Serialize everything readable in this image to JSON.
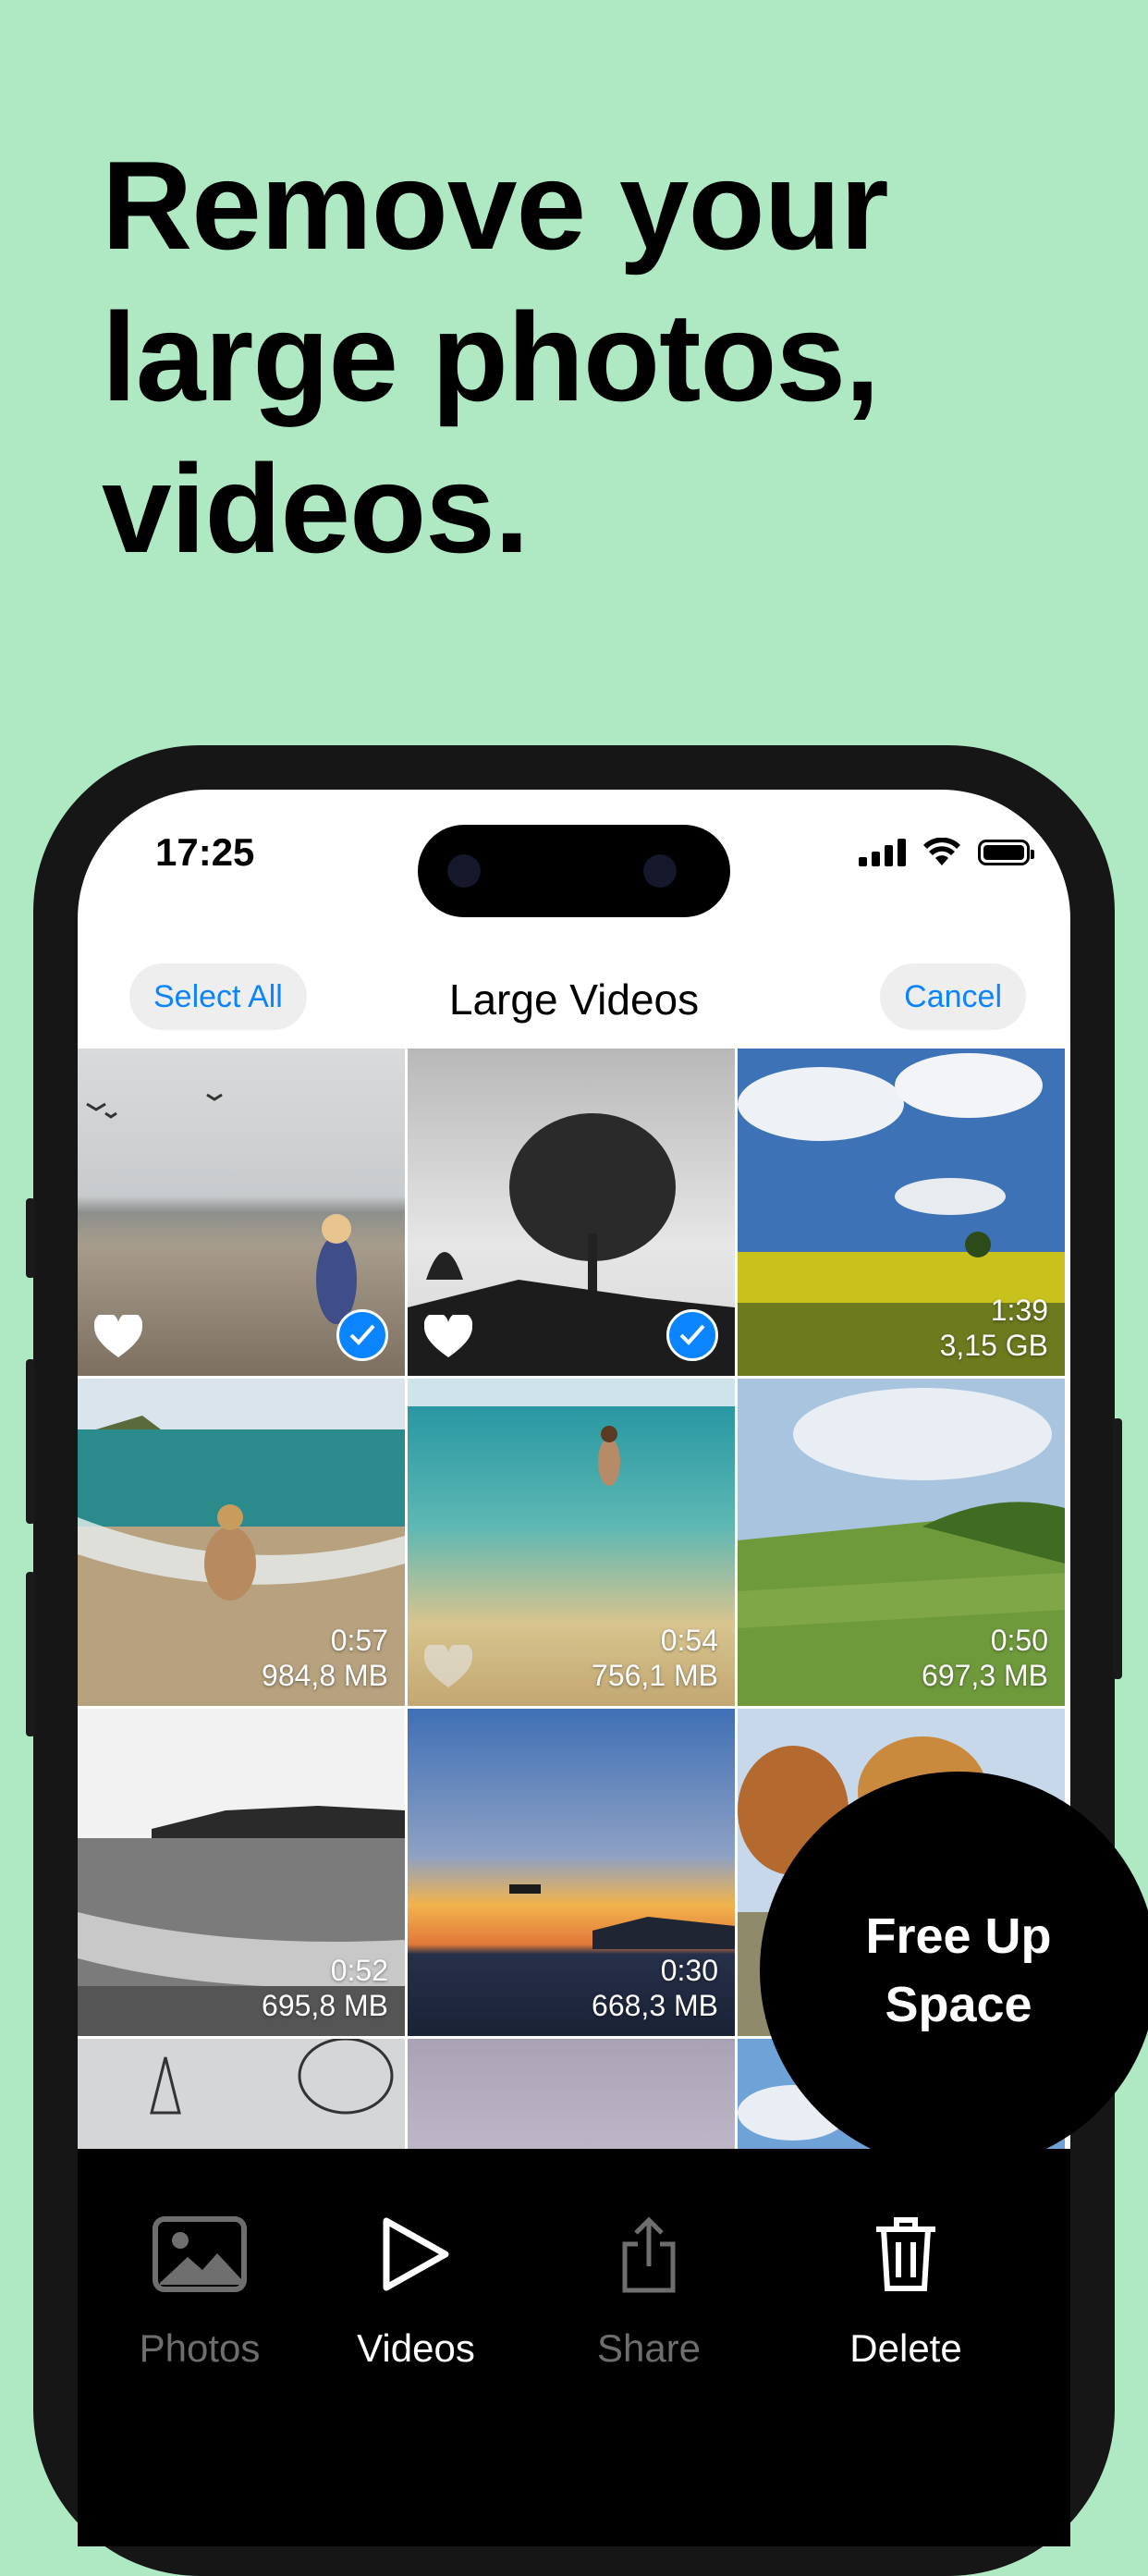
{
  "headline": [
    "Remove your",
    "large photos,",
    "videos."
  ],
  "status": {
    "time": "17:25"
  },
  "navbar": {
    "select_all": "Select All",
    "title": "Large Videos",
    "cancel": "Cancel"
  },
  "grid": [
    {
      "name": "beach-child",
      "favorite": true,
      "selected": true,
      "duration": "",
      "size": ""
    },
    {
      "name": "tree-silhouette",
      "favorite": true,
      "selected": true,
      "duration": "",
      "size": ""
    },
    {
      "name": "field-sky",
      "favorite": false,
      "selected": false,
      "duration": "1:39",
      "size": "3,15 GB"
    },
    {
      "name": "beach-woman-sitting",
      "favorite": false,
      "selected": false,
      "duration": "0:57",
      "size": "984,8 MB"
    },
    {
      "name": "sea-woman-standing",
      "favorite": false,
      "selected": false,
      "duration": "0:54",
      "size": "756,1 MB"
    },
    {
      "name": "green-hills",
      "favorite": false,
      "selected": false,
      "duration": "0:50",
      "size": "697,3 MB"
    },
    {
      "name": "bw-coast",
      "favorite": false,
      "selected": false,
      "duration": "0:52",
      "size": "695,8 MB"
    },
    {
      "name": "sunset-drone",
      "favorite": false,
      "selected": false,
      "duration": "0:30",
      "size": "668,3 MB"
    },
    {
      "name": "autumn-trees",
      "favorite": false,
      "selected": false,
      "duration": "",
      "size": ""
    },
    {
      "name": "pylon-tree",
      "favorite": false,
      "selected": false,
      "duration": "",
      "size": ""
    },
    {
      "name": "dusk-sky",
      "favorite": false,
      "selected": false,
      "duration": "",
      "size": ""
    },
    {
      "name": "blue-sky",
      "favorite": false,
      "selected": false,
      "duration": "",
      "size": ""
    }
  ],
  "tabbar": {
    "photos": "Photos",
    "videos": "Videos",
    "share": "Share",
    "delete": "Delete"
  },
  "badge": [
    "Free Up",
    "Space"
  ],
  "colors": {
    "background": "#aee9c4",
    "accent": "#0a84ff",
    "phone": "#161616"
  }
}
